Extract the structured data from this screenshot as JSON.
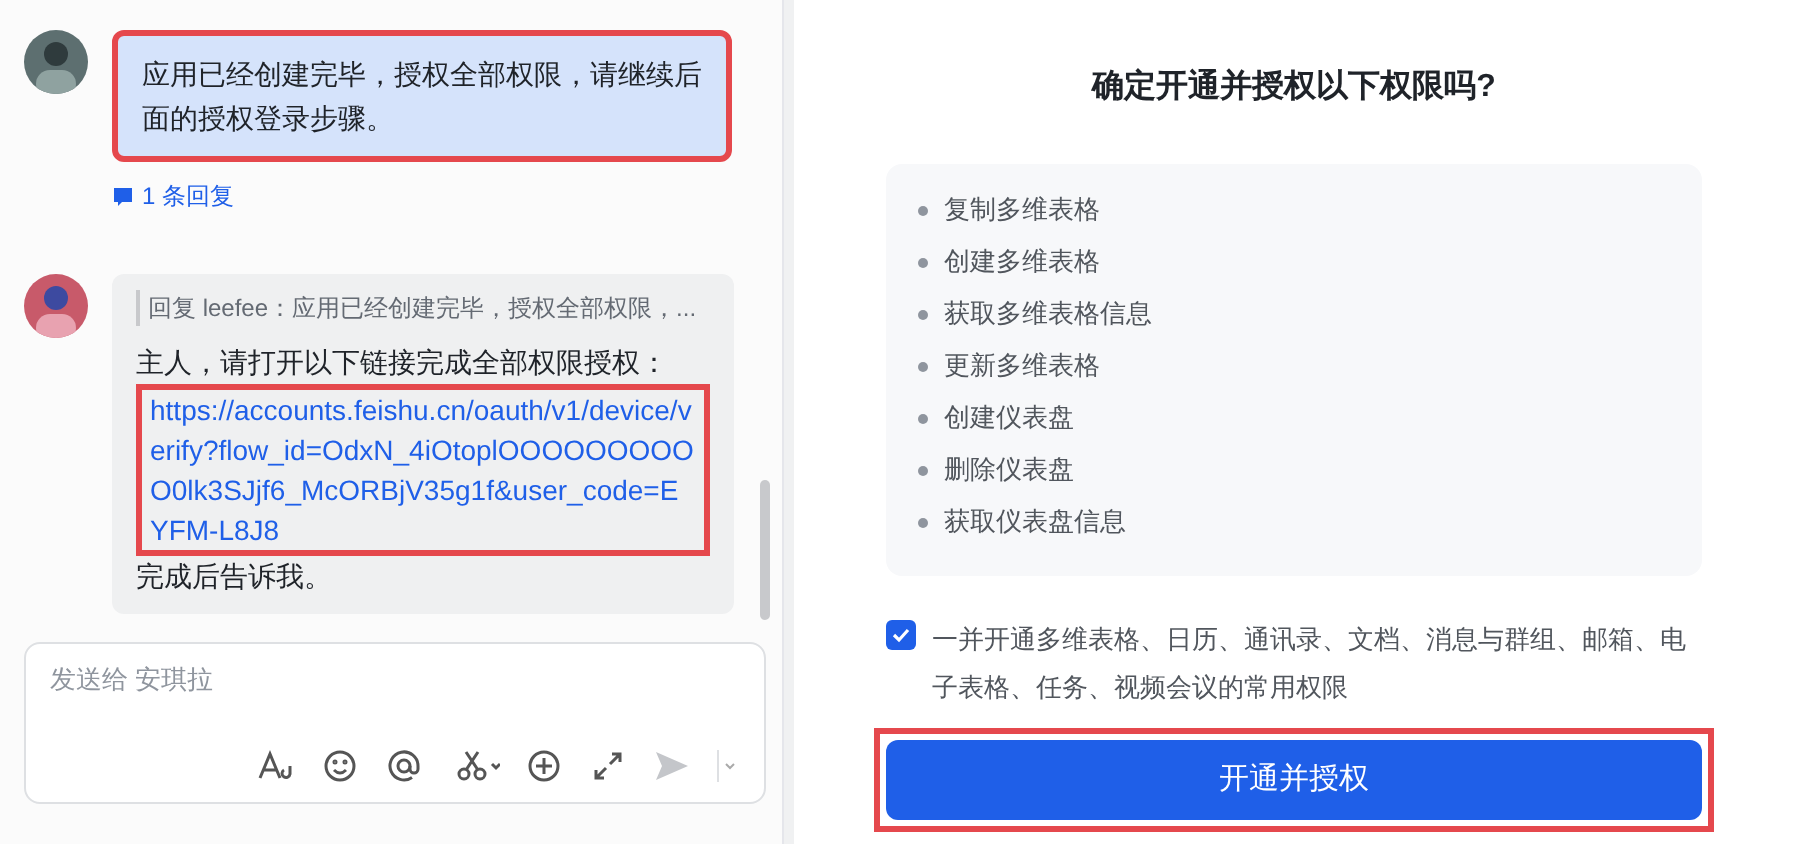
{
  "chat": {
    "messages": [
      {
        "kind": "plain",
        "text": "应用已经创建完毕，授权全部权限，请继续后面的授权登录步骤。",
        "highlighted": true,
        "replies": "1 条回复"
      },
      {
        "kind": "reply",
        "quote": "回复 leefee：应用已经创建完毕，授权全部权限，...",
        "intro": "主人，请打开以下链接完成全部权限授权：",
        "link": "https://accounts.feishu.cn/oauth/v1/device/verify?flow_id=OdxN_4iOtoplOOOOOOOOOO0lk3SJjf6_McORBjV35g1f&user_code=EYFM-L8J8",
        "link_highlighted": true,
        "outro": "完成后告诉我。"
      }
    ],
    "input": {
      "placeholder": "发送给 安琪拉"
    }
  },
  "dialog": {
    "title": "确定开通并授权以下权限吗?",
    "permissions": [
      "复制多维表格",
      "创建多维表格",
      "获取多维表格信息",
      "更新多维表格",
      "创建仪表盘",
      "删除仪表盘",
      "获取仪表盘信息"
    ],
    "also_enable": {
      "checked": true,
      "label": "一并开通多维表格、日历、通讯录、文档、消息与群组、邮箱、电子表格、任务、视频会议的常用权限"
    },
    "confirm": {
      "label": "开通并授权",
      "highlighted": true
    }
  }
}
